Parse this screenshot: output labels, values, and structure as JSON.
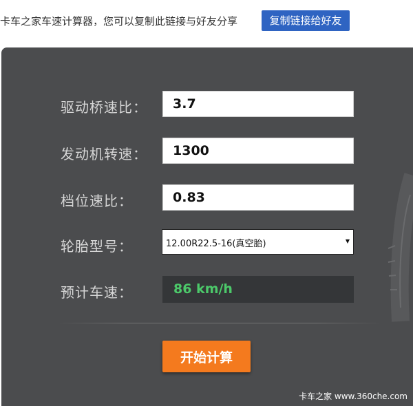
{
  "header": {
    "share_text": "卡车之家车速计算器，您可以复制此链接与好友分享",
    "copy_button_label": "复制链接给好友"
  },
  "form": {
    "axle_ratio": {
      "label": "驱动桥速比：",
      "value": "3.7"
    },
    "engine_speed": {
      "label": "发动机转速：",
      "value": "1300"
    },
    "gear_ratio": {
      "label": "档位速比：",
      "value": "0.83"
    },
    "tire_model": {
      "label": "轮胎型号：",
      "selected": "12.00R22.5-16(真空胎)"
    },
    "estimated_speed": {
      "label": "预计车速：",
      "value": "86 km/h"
    }
  },
  "actions": {
    "calculate_label": "开始计算"
  },
  "footer": {
    "watermark": "卡车之家 www.360che.com"
  },
  "colors": {
    "panel_background": "#4b4c4e",
    "copy_button": "#2f64c2",
    "calculate_button": "#f47a1e",
    "result_text": "#4cc96a"
  }
}
